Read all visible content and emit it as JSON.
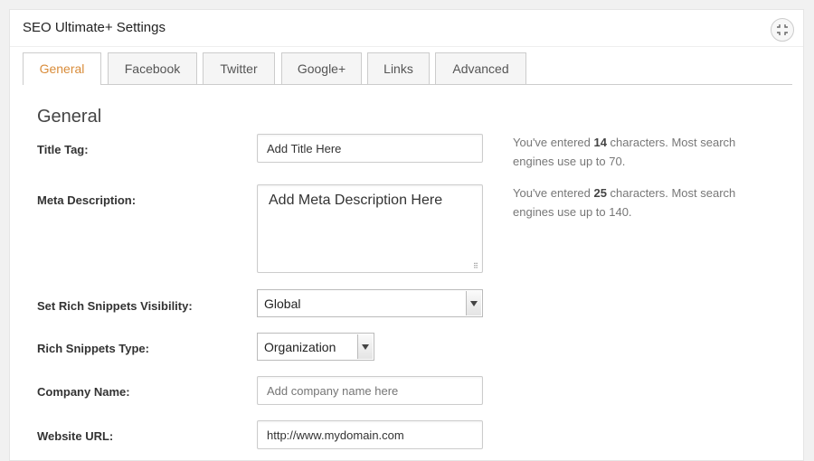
{
  "panel": {
    "title": "SEO Ultimate+ Settings",
    "toggle_icon": "expand-arrows-icon"
  },
  "tabs": [
    {
      "label": "General",
      "active": true
    },
    {
      "label": "Facebook",
      "active": false
    },
    {
      "label": "Twitter",
      "active": false
    },
    {
      "label": "Google+",
      "active": false
    },
    {
      "label": "Links",
      "active": false
    },
    {
      "label": "Advanced",
      "active": false
    }
  ],
  "section": {
    "title": "General"
  },
  "fields": {
    "title_tag": {
      "label": "Title Tag:",
      "value": "Add Title Here",
      "hint_prefix": "You've entered ",
      "hint_count": "14",
      "hint_suffix": " characters. Most search engines use up to 70."
    },
    "meta_description": {
      "label": "Meta Description:",
      "value": "Add Meta Description Here",
      "hint_prefix": "You've entered ",
      "hint_count": "25",
      "hint_suffix": " characters. Most search engines use up to 140."
    },
    "rich_snippets_visibility": {
      "label": "Set Rich Snippets Visibility:",
      "selected": "Global"
    },
    "rich_snippets_type": {
      "label": "Rich Snippets Type:",
      "selected": "Organization"
    },
    "company_name": {
      "label": "Company Name:",
      "placeholder": "Add company name here"
    },
    "website_url": {
      "label": "Website URL:",
      "value": "http://www.mydomain.com"
    }
  },
  "colors": {
    "active_tab": "#d98c3a",
    "border": "#cccccc"
  }
}
